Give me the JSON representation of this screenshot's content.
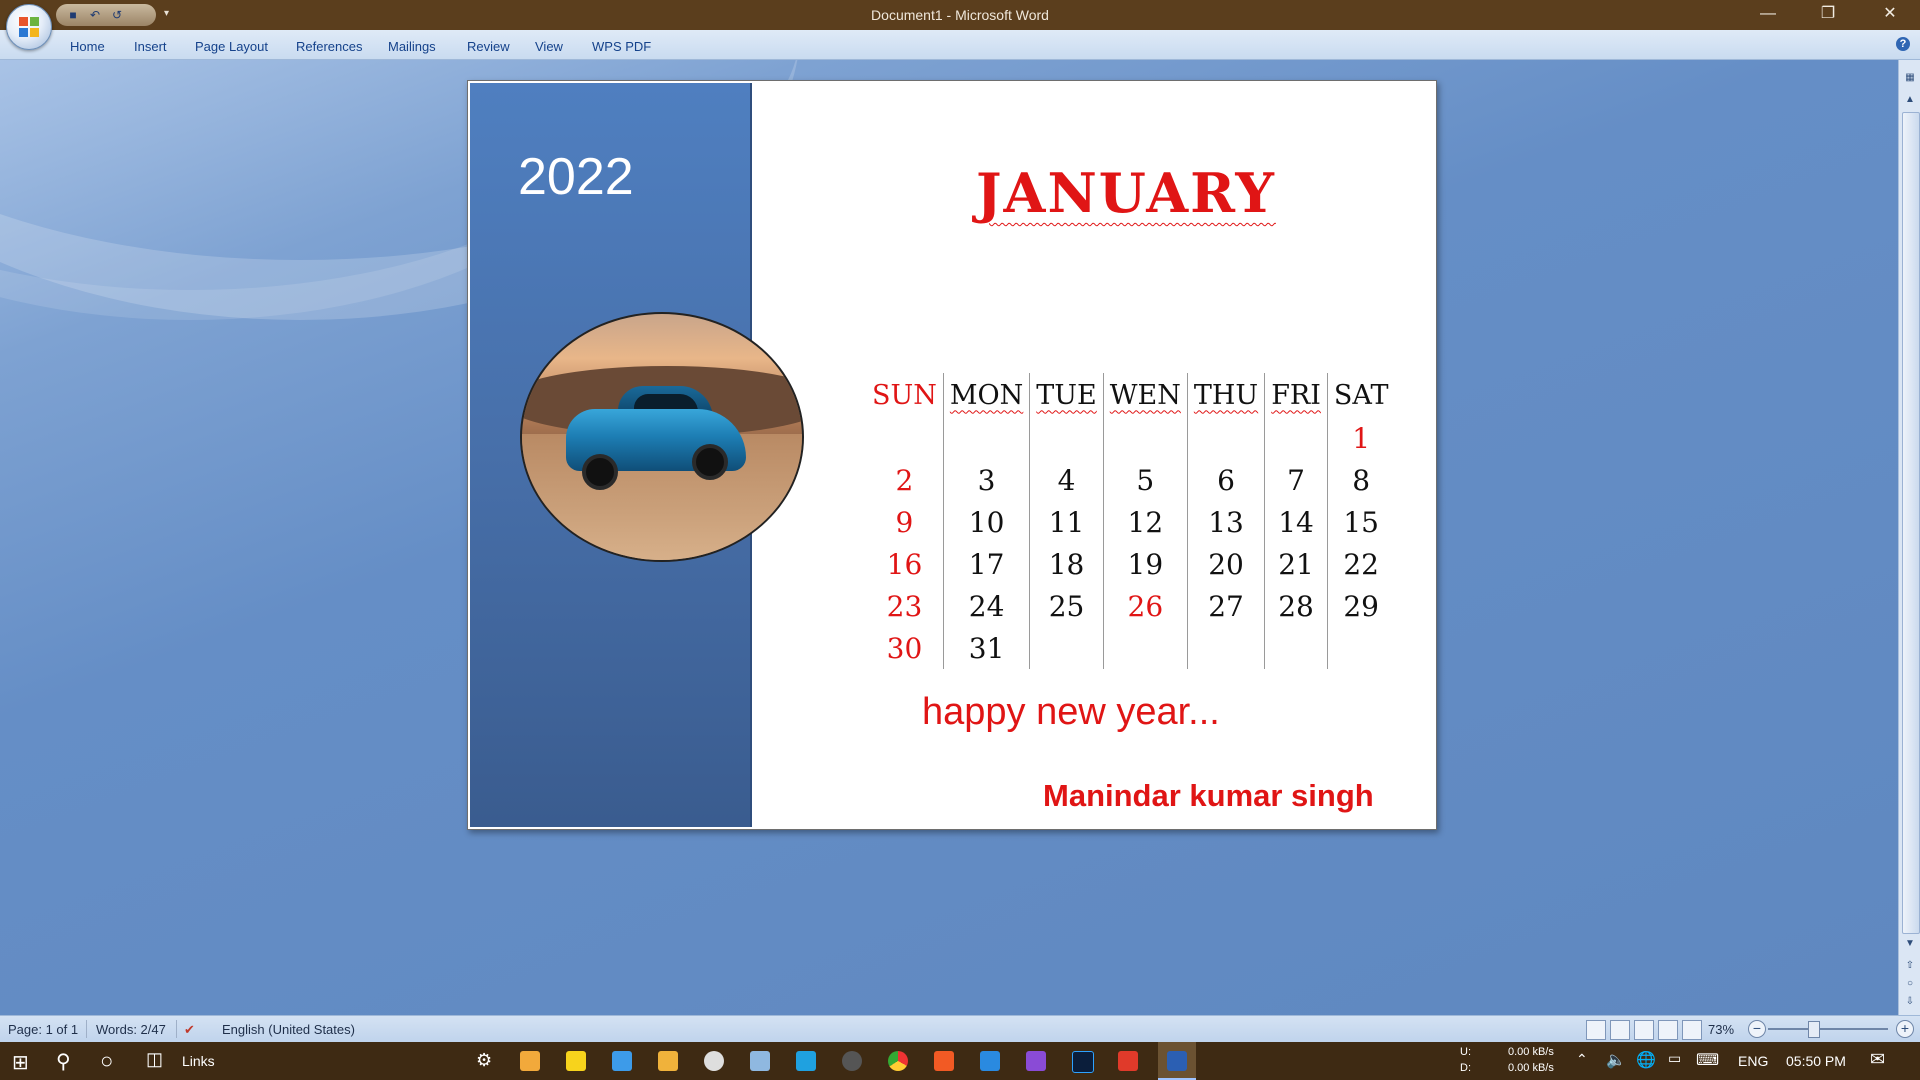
{
  "window": {
    "title": "Document1 - Microsoft Word"
  },
  "ribbon": {
    "tabs": [
      "Home",
      "Insert",
      "Page Layout",
      "References",
      "Mailings",
      "Review",
      "View",
      "WPS PDF"
    ]
  },
  "document": {
    "year": "2022",
    "month": "JANUARY",
    "weekdays": [
      "SUN",
      "MON",
      "TUE",
      "WEN",
      "THU",
      "FRI",
      "SAT"
    ],
    "weeks": [
      [
        "",
        "",
        "",
        "",
        "",
        "",
        "1"
      ],
      [
        "2",
        "3",
        "4",
        "5",
        "6",
        "7",
        "8"
      ],
      [
        "9",
        "10",
        "11",
        "12",
        "13",
        "14",
        "15"
      ],
      [
        "16",
        "17",
        "18",
        "19",
        "20",
        "21",
        "22"
      ],
      [
        "23",
        "24",
        "25",
        "26",
        "27",
        "28",
        "29"
      ],
      [
        "30",
        "31",
        "",
        "",
        "",
        "",
        ""
      ]
    ],
    "greeting": "happy new year...",
    "author": "Manindar kumar singh"
  },
  "statusbar": {
    "page": "Page: 1 of 1",
    "words": "Words: 2/47",
    "language": "English (United States)",
    "zoom": "73%"
  },
  "taskbar": {
    "links_label": "Links",
    "net_up_label": "U:",
    "net_down_label": "D:",
    "net_up": "0.00 kB/s",
    "net_down": "0.00 kB/s",
    "language": "ENG",
    "time": "05:50 PM"
  },
  "colors": {
    "accent_red": "#e01515",
    "sidebar_blue": "#476fa9",
    "titlebar_brown": "#5b3e1d"
  }
}
